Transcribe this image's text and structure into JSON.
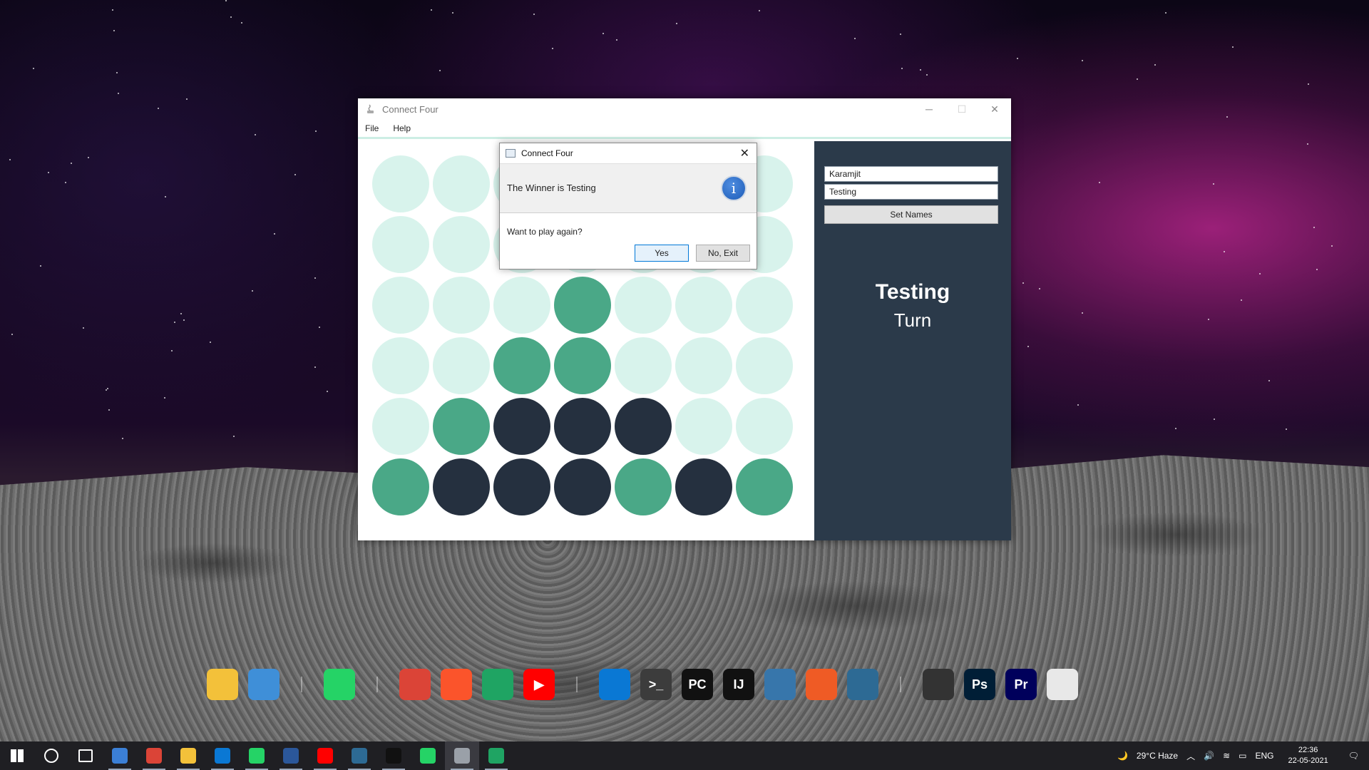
{
  "app": {
    "title": "Connect Four",
    "menu": [
      "File",
      "Help"
    ],
    "controls": {
      "minimize": "─",
      "maximize": "☐",
      "close": "✕"
    }
  },
  "board": {
    "rows": 6,
    "cols": 7,
    "grid": [
      [
        "e",
        "e",
        "e",
        "e",
        "e",
        "e",
        "e"
      ],
      [
        "e",
        "e",
        "e",
        "e",
        "e",
        "e",
        "e"
      ],
      [
        "e",
        "e",
        "e",
        "g",
        "e",
        "e",
        "e"
      ],
      [
        "e",
        "e",
        "g",
        "g",
        "e",
        "e",
        "e"
      ],
      [
        "e",
        "g",
        "d",
        "d",
        "d",
        "e",
        "e"
      ],
      [
        "g",
        "d",
        "d",
        "d",
        "g",
        "d",
        "g"
      ]
    ],
    "colors": {
      "empty": "#d8f3ec",
      "green": "#4aa887",
      "dark": "#25303f"
    }
  },
  "side": {
    "player1_value": "Karamjit",
    "player2_value": "Testing",
    "set_names_label": "Set Names",
    "turn_name": "Testing",
    "turn_label": "Turn",
    "background": "#2b3a4a"
  },
  "dialog": {
    "title": "Connect Four",
    "close": "✕",
    "message": "The Winner is Testing",
    "question": "Want to play again?",
    "info_glyph": "i",
    "yes_label": "Yes",
    "no_label": "No, Exit"
  },
  "dock": {
    "icons": [
      {
        "name": "file-explorer-icon",
        "color": "#f3c13a",
        "text": ""
      },
      {
        "name": "this-pc-icon",
        "color": "#3f8fd8",
        "text": ""
      },
      {
        "sep": true
      },
      {
        "name": "whatsapp-icon",
        "color": "#25d366",
        "text": ""
      },
      {
        "sep": true
      },
      {
        "name": "chrome-icon",
        "color": "#db4437",
        "text": ""
      },
      {
        "name": "brave-icon",
        "color": "#fb542b",
        "text": ""
      },
      {
        "name": "google-drive-icon",
        "color": "#1fa463",
        "text": ""
      },
      {
        "name": "youtube-icon",
        "color": "#ff0000",
        "text": "▶"
      },
      {
        "sep": true
      },
      {
        "name": "vscode-icon",
        "color": "#0a78d4",
        "text": ""
      },
      {
        "name": "terminal-icon",
        "color": "#3c3c3c",
        "text": ">_"
      },
      {
        "name": "pycharm-icon",
        "color": "#111111",
        "text": "PC"
      },
      {
        "name": "intellij-icon",
        "color": "#111111",
        "text": "IJ"
      },
      {
        "name": "python-icon",
        "color": "#3776ab",
        "text": ""
      },
      {
        "name": "postman-icon",
        "color": "#ef5b25",
        "text": ""
      },
      {
        "name": "mysql-workbench-icon",
        "color": "#2d6a94",
        "text": ""
      },
      {
        "sep": true
      },
      {
        "name": "davinci-icon",
        "color": "#333333",
        "text": ""
      },
      {
        "name": "photoshop-icon",
        "color": "#001e36",
        "text": "Ps"
      },
      {
        "name": "premiere-icon",
        "color": "#00005b",
        "text": "Pr"
      },
      {
        "name": "recycle-bin-icon",
        "color": "#e8e8e8",
        "text": ""
      }
    ]
  },
  "taskbar": {
    "apps": [
      {
        "name": "start-icon",
        "color": "#ffffff",
        "open": false
      },
      {
        "name": "search-icon",
        "color": "#ffffff",
        "open": false
      },
      {
        "name": "task-view-icon",
        "color": "#ffffff",
        "open": false
      },
      {
        "name": "taskbar-onenote-icon",
        "color": "#3b7fd6",
        "open": true
      },
      {
        "name": "taskbar-chrome-icon",
        "color": "#db4437",
        "open": true
      },
      {
        "name": "taskbar-explorer-icon",
        "color": "#f3c13a",
        "open": true
      },
      {
        "name": "taskbar-vscode-icon",
        "color": "#0a78d4",
        "open": true
      },
      {
        "name": "taskbar-whatsapp-icon",
        "color": "#25d366",
        "open": true
      },
      {
        "name": "taskbar-word-icon",
        "color": "#2b579a",
        "open": true
      },
      {
        "name": "taskbar-youtube-icon",
        "color": "#ff0000",
        "open": true
      },
      {
        "name": "taskbar-mysql-icon",
        "color": "#2d6a94",
        "open": true
      },
      {
        "name": "taskbar-intellij-icon",
        "color": "#111111",
        "open": true
      },
      {
        "name": "taskbar-whatsapp2-icon",
        "color": "#25d366",
        "open": false
      },
      {
        "name": "taskbar-java-icon",
        "color": "#9aa0a8",
        "open": true,
        "active": true
      },
      {
        "name": "taskbar-drive-icon",
        "color": "#1fa463",
        "open": true
      }
    ],
    "weather": "29°C  Haze",
    "language": "ENG",
    "time": "22:36",
    "date": "22-05-2021"
  }
}
